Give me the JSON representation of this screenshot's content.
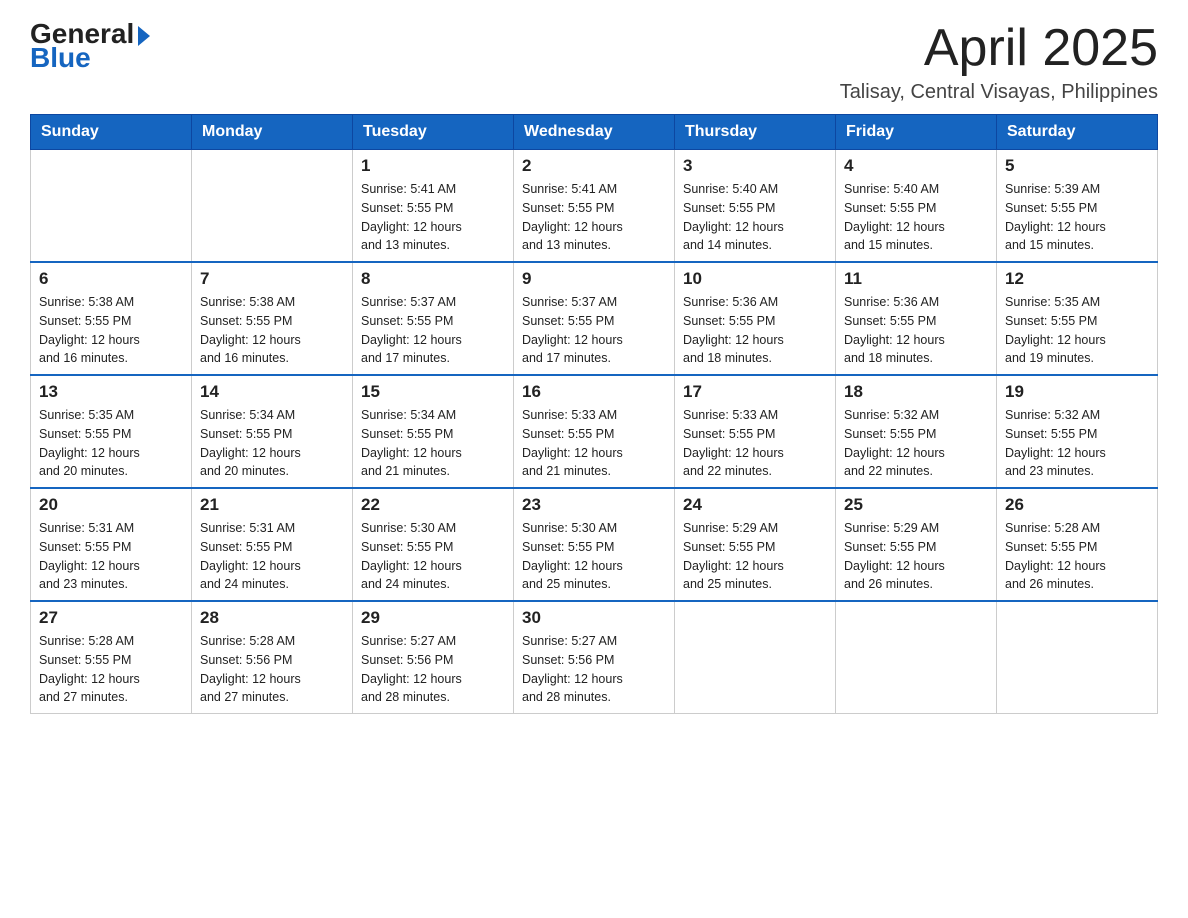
{
  "logo": {
    "general": "General",
    "blue": "Blue"
  },
  "title": "April 2025",
  "subtitle": "Talisay, Central Visayas, Philippines",
  "headers": [
    "Sunday",
    "Monday",
    "Tuesday",
    "Wednesday",
    "Thursday",
    "Friday",
    "Saturday"
  ],
  "weeks": [
    [
      {
        "day": "",
        "info": ""
      },
      {
        "day": "",
        "info": ""
      },
      {
        "day": "1",
        "info": "Sunrise: 5:41 AM\nSunset: 5:55 PM\nDaylight: 12 hours\nand 13 minutes."
      },
      {
        "day": "2",
        "info": "Sunrise: 5:41 AM\nSunset: 5:55 PM\nDaylight: 12 hours\nand 13 minutes."
      },
      {
        "day": "3",
        "info": "Sunrise: 5:40 AM\nSunset: 5:55 PM\nDaylight: 12 hours\nand 14 minutes."
      },
      {
        "day": "4",
        "info": "Sunrise: 5:40 AM\nSunset: 5:55 PM\nDaylight: 12 hours\nand 15 minutes."
      },
      {
        "day": "5",
        "info": "Sunrise: 5:39 AM\nSunset: 5:55 PM\nDaylight: 12 hours\nand 15 minutes."
      }
    ],
    [
      {
        "day": "6",
        "info": "Sunrise: 5:38 AM\nSunset: 5:55 PM\nDaylight: 12 hours\nand 16 minutes."
      },
      {
        "day": "7",
        "info": "Sunrise: 5:38 AM\nSunset: 5:55 PM\nDaylight: 12 hours\nand 16 minutes."
      },
      {
        "day": "8",
        "info": "Sunrise: 5:37 AM\nSunset: 5:55 PM\nDaylight: 12 hours\nand 17 minutes."
      },
      {
        "day": "9",
        "info": "Sunrise: 5:37 AM\nSunset: 5:55 PM\nDaylight: 12 hours\nand 17 minutes."
      },
      {
        "day": "10",
        "info": "Sunrise: 5:36 AM\nSunset: 5:55 PM\nDaylight: 12 hours\nand 18 minutes."
      },
      {
        "day": "11",
        "info": "Sunrise: 5:36 AM\nSunset: 5:55 PM\nDaylight: 12 hours\nand 18 minutes."
      },
      {
        "day": "12",
        "info": "Sunrise: 5:35 AM\nSunset: 5:55 PM\nDaylight: 12 hours\nand 19 minutes."
      }
    ],
    [
      {
        "day": "13",
        "info": "Sunrise: 5:35 AM\nSunset: 5:55 PM\nDaylight: 12 hours\nand 20 minutes."
      },
      {
        "day": "14",
        "info": "Sunrise: 5:34 AM\nSunset: 5:55 PM\nDaylight: 12 hours\nand 20 minutes."
      },
      {
        "day": "15",
        "info": "Sunrise: 5:34 AM\nSunset: 5:55 PM\nDaylight: 12 hours\nand 21 minutes."
      },
      {
        "day": "16",
        "info": "Sunrise: 5:33 AM\nSunset: 5:55 PM\nDaylight: 12 hours\nand 21 minutes."
      },
      {
        "day": "17",
        "info": "Sunrise: 5:33 AM\nSunset: 5:55 PM\nDaylight: 12 hours\nand 22 minutes."
      },
      {
        "day": "18",
        "info": "Sunrise: 5:32 AM\nSunset: 5:55 PM\nDaylight: 12 hours\nand 22 minutes."
      },
      {
        "day": "19",
        "info": "Sunrise: 5:32 AM\nSunset: 5:55 PM\nDaylight: 12 hours\nand 23 minutes."
      }
    ],
    [
      {
        "day": "20",
        "info": "Sunrise: 5:31 AM\nSunset: 5:55 PM\nDaylight: 12 hours\nand 23 minutes."
      },
      {
        "day": "21",
        "info": "Sunrise: 5:31 AM\nSunset: 5:55 PM\nDaylight: 12 hours\nand 24 minutes."
      },
      {
        "day": "22",
        "info": "Sunrise: 5:30 AM\nSunset: 5:55 PM\nDaylight: 12 hours\nand 24 minutes."
      },
      {
        "day": "23",
        "info": "Sunrise: 5:30 AM\nSunset: 5:55 PM\nDaylight: 12 hours\nand 25 minutes."
      },
      {
        "day": "24",
        "info": "Sunrise: 5:29 AM\nSunset: 5:55 PM\nDaylight: 12 hours\nand 25 minutes."
      },
      {
        "day": "25",
        "info": "Sunrise: 5:29 AM\nSunset: 5:55 PM\nDaylight: 12 hours\nand 26 minutes."
      },
      {
        "day": "26",
        "info": "Sunrise: 5:28 AM\nSunset: 5:55 PM\nDaylight: 12 hours\nand 26 minutes."
      }
    ],
    [
      {
        "day": "27",
        "info": "Sunrise: 5:28 AM\nSunset: 5:55 PM\nDaylight: 12 hours\nand 27 minutes."
      },
      {
        "day": "28",
        "info": "Sunrise: 5:28 AM\nSunset: 5:56 PM\nDaylight: 12 hours\nand 27 minutes."
      },
      {
        "day": "29",
        "info": "Sunrise: 5:27 AM\nSunset: 5:56 PM\nDaylight: 12 hours\nand 28 minutes."
      },
      {
        "day": "30",
        "info": "Sunrise: 5:27 AM\nSunset: 5:56 PM\nDaylight: 12 hours\nand 28 minutes."
      },
      {
        "day": "",
        "info": ""
      },
      {
        "day": "",
        "info": ""
      },
      {
        "day": "",
        "info": ""
      }
    ]
  ]
}
